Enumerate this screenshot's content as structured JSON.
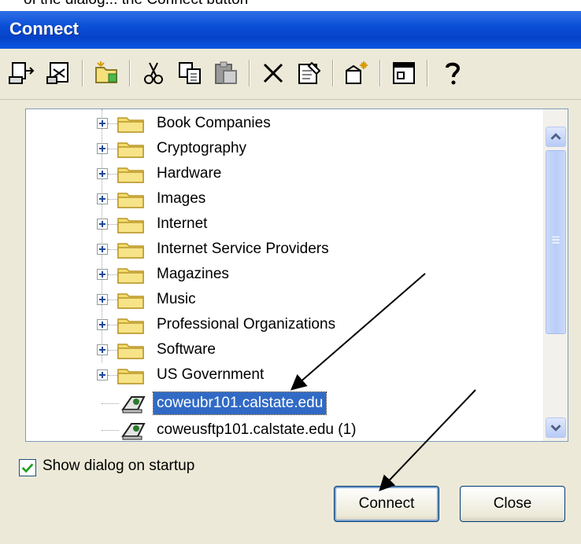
{
  "top_text": "of the dialog... the Connect button",
  "window": {
    "title": "Connect"
  },
  "toolbar": {
    "buttons": [
      {
        "icon": "connect-icon"
      },
      {
        "icon": "disconnect-icon"
      },
      {
        "icon": "new-folder-icon"
      },
      {
        "icon": "cut-icon"
      },
      {
        "icon": "copy-icon"
      },
      {
        "icon": "paste-icon"
      },
      {
        "icon": "delete-icon"
      },
      {
        "icon": "properties-icon"
      },
      {
        "icon": "new-site-icon"
      },
      {
        "icon": "view-icon"
      },
      {
        "icon": "help-icon"
      }
    ]
  },
  "tree": {
    "folders": [
      "Book Companies",
      "Cryptography",
      "Hardware",
      "Images",
      "Internet",
      "Internet Service Providers",
      "Magazines",
      "Music",
      "Professional Organizations",
      "Software",
      "US Government"
    ],
    "sites": [
      {
        "label": "coweubr101.calstate.edu",
        "selected": true
      },
      {
        "label": "coweusftp101.calstate.edu (1)",
        "selected": false
      }
    ]
  },
  "options": {
    "show_on_startup_label": "Show dialog on startup",
    "show_on_startup_checked": true
  },
  "buttons": {
    "connect_label": "Connect",
    "close_label": "Close"
  },
  "colors": {
    "title_bar": "#0a4fd6",
    "selection": "#316ac5",
    "dialog_bg": "#ece9d8"
  }
}
